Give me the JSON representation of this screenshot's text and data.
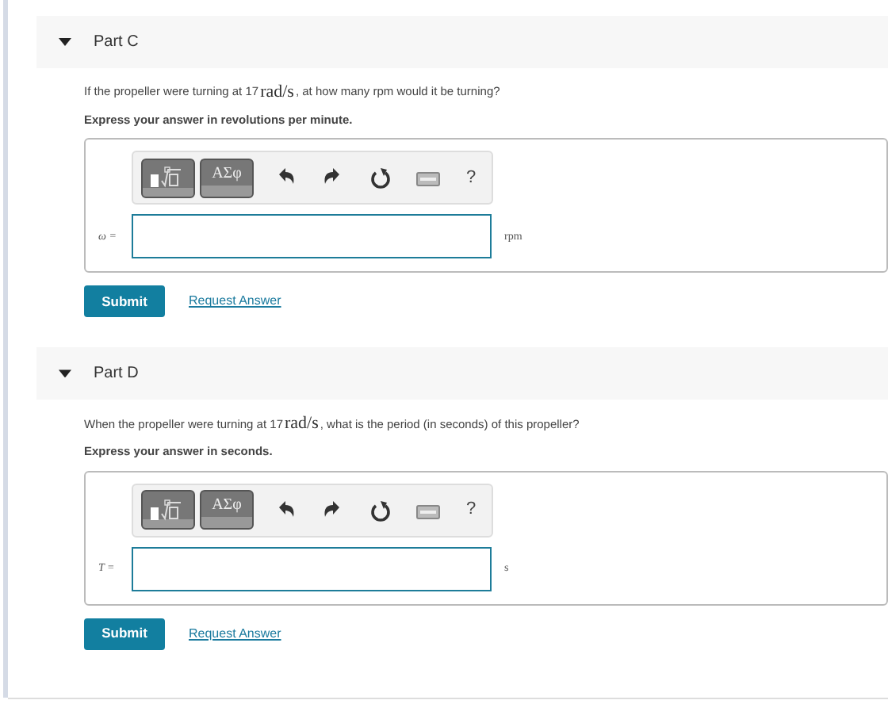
{
  "parts": [
    {
      "title": "Part C",
      "expanded": true,
      "question_start": "If the propeller were turning at 17 ",
      "question_unit": "rad/s",
      "question_end": " , at how many rpm would it be turning?",
      "instruction": "Express your answer in revolutions per minute.",
      "symbols_button": "ΑΣφ",
      "help_button": "?",
      "variable": "ω =",
      "answer_unit": "rpm",
      "submit": "Submit",
      "request": "Request Answer"
    },
    {
      "title": "Part D",
      "expanded": true,
      "question_start": "When the propeller were turning at 17 ",
      "question_unit": "rad/s",
      "question_end": " , what is the period (in seconds) of this propeller?",
      "instruction": "Express your answer in seconds.",
      "symbols_button": "ΑΣφ",
      "help_button": "?",
      "variable": "T =",
      "answer_unit": "s",
      "submit": "Submit",
      "request": "Request Answer"
    }
  ]
}
